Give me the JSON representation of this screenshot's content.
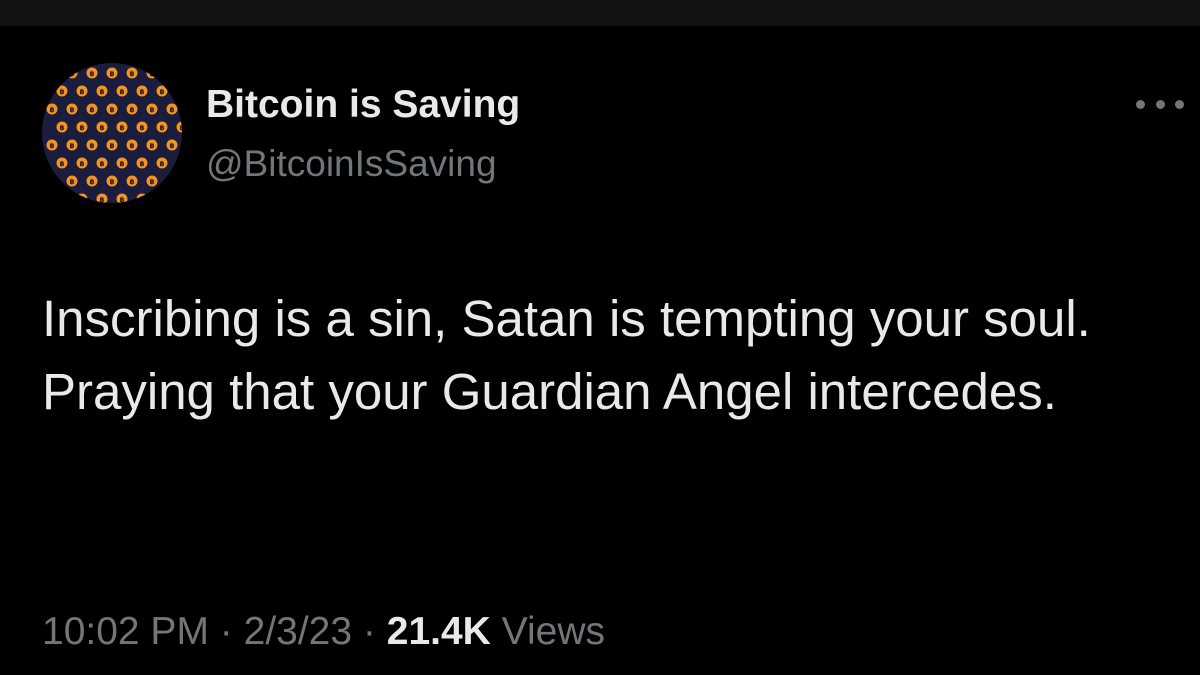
{
  "tweet": {
    "author": {
      "display_name": "Bitcoin is Saving",
      "handle": "@BitcoinIsSaving",
      "avatar_icon": "bitcoin-pattern-avatar-icon"
    },
    "more_icon": "more-horizontal-icon",
    "text": "Inscribing is a sin, Satan is tempting your soul. Praying that your Guardian Angel intercedes.",
    "time": "10:02 PM",
    "date": "2/3/23",
    "separator": "·",
    "views_count": "21.4K",
    "views_label": "Views"
  },
  "colors": {
    "background": "#000000",
    "primary_text": "#e7e9ea",
    "secondary_text": "#71767b",
    "avatar_background": "#1b1d3f",
    "bitcoin_orange": "#f7931a"
  }
}
